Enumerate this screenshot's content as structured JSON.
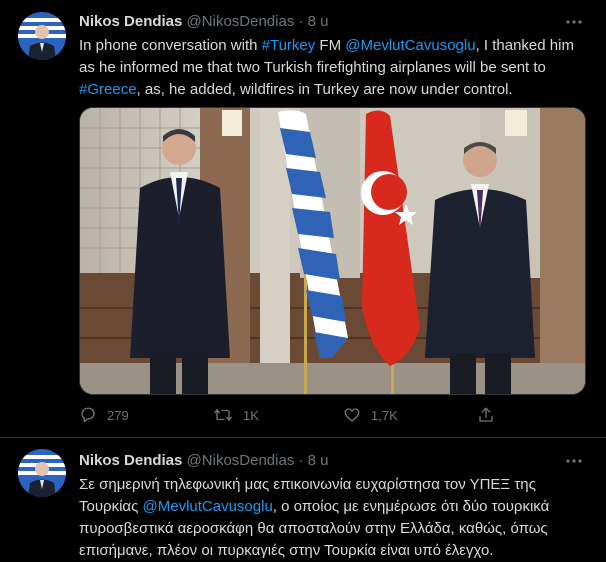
{
  "tweets": [
    {
      "author": {
        "name": "Nikos Dendias",
        "handle": "@NikosDendias",
        "separator": "·",
        "time": "8 u"
      },
      "text": {
        "p1": "In phone conversation with ",
        "hashtag_turkey": "#Turkey",
        "p2": " FM ",
        "mention": "@MevlutCavusoglu",
        "p3": ", I thanked him as he informed me that two Turkish firefighting airplanes will be sent to ",
        "hashtag_greece": "#Greece",
        "p4": ", as, he added, wildfires in Turkey are now under control."
      },
      "actions": {
        "reply_count": "279",
        "retweet_count": "1K",
        "like_count": "1,7K"
      }
    },
    {
      "author": {
        "name": "Nikos Dendias",
        "handle": "@NikosDendias",
        "separator": "·",
        "time": "8 u"
      },
      "text": {
        "p1": "Σε σημερινή τηλεφωνική μας επικοινωνία ευχαρίστησα τον ΥΠΕΞ της Τουρκίας ",
        "mention": "@MevlutCavusoglu",
        "p2": ", ο οποίος με ενημέρωσε ότι δύο τουρκικά πυροσβεστικά αεροσκάφη θα αποσταλούν στην Ελλάδα, καθώς, όπως επισήμανε, πλέον οι πυρκαγιές στην Τουρκία είναι υπό έλεγχο."
      }
    }
  ],
  "colors": {
    "background": "#000000",
    "text": "#d9d9d9",
    "secondary": "#6e767d",
    "link": "#1d9bf0",
    "divider": "#2f3336"
  },
  "icons": [
    "more-icon",
    "reply-icon",
    "retweet-icon",
    "like-icon",
    "share-icon"
  ]
}
